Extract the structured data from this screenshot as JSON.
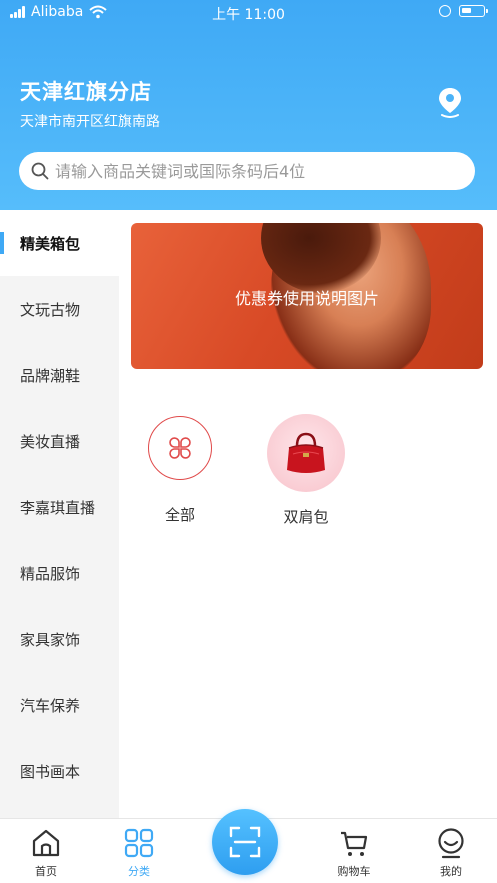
{
  "status_bar": {
    "carrier": "Alibaba",
    "time": "上午 11:00"
  },
  "header": {
    "store_name": "天津红旗分店",
    "store_address": "天津市南开区红旗南路"
  },
  "search": {
    "placeholder": "请输入商品关键词或国际条码后4位",
    "value": ""
  },
  "sidebar": {
    "items": [
      {
        "label": "精美箱包",
        "active": true
      },
      {
        "label": "文玩古物",
        "active": false
      },
      {
        "label": "品牌潮鞋",
        "active": false
      },
      {
        "label": "美妆直播",
        "active": false
      },
      {
        "label": "李嘉琪直播",
        "active": false
      },
      {
        "label": "精品服饰",
        "active": false
      },
      {
        "label": "家具家饰",
        "active": false
      },
      {
        "label": "汽车保养",
        "active": false
      },
      {
        "label": "图书画本",
        "active": false
      }
    ]
  },
  "banner": {
    "text": "优惠券使用说明图片"
  },
  "categories": [
    {
      "label": "全部",
      "icon": "clover-icon"
    },
    {
      "label": "双肩包",
      "icon": "handbag-icon"
    }
  ],
  "tabbar": {
    "items": [
      {
        "label": "首页",
        "icon": "home-icon",
        "active": false
      },
      {
        "label": "分类",
        "icon": "grid-icon",
        "active": true
      },
      {
        "label": "",
        "icon": "scan-icon",
        "active": false
      },
      {
        "label": "购物车",
        "icon": "cart-icon",
        "active": false
      },
      {
        "label": "我的",
        "icon": "profile-icon",
        "active": false
      }
    ]
  },
  "colors": {
    "accent": "#3fa9f5",
    "category_outline": "#e04a4a",
    "sidebar_bg": "#f4f4f4"
  }
}
